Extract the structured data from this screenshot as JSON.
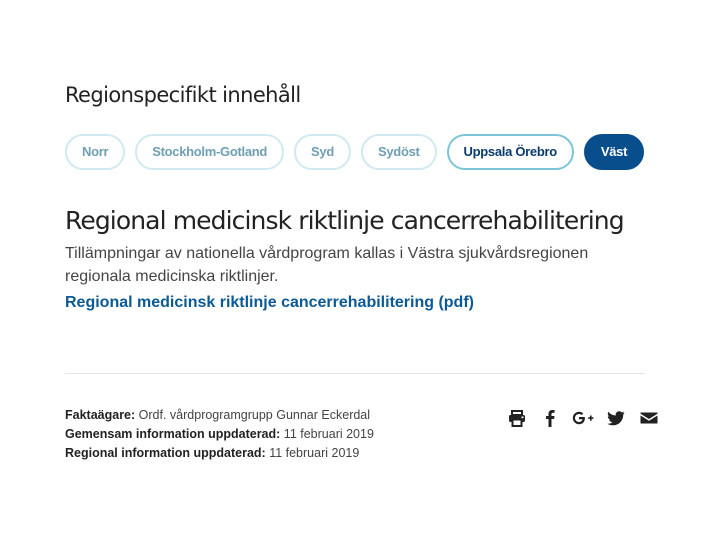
{
  "region_section": {
    "title": "Regionspecifikt innehåll",
    "regions": [
      {
        "label": "Norr",
        "state": "default"
      },
      {
        "label": "Stockholm-Gotland",
        "state": "default"
      },
      {
        "label": "Syd",
        "state": "default"
      },
      {
        "label": "Sydöst",
        "state": "default"
      },
      {
        "label": "Uppsala Örebro",
        "state": "highlight"
      },
      {
        "label": "Väst",
        "state": "active"
      }
    ]
  },
  "content": {
    "heading": "Regional medicinsk riktlinje cancerrehabilitering",
    "body": "Tillämpningar av nationella vårdprogram kallas i Västra sjukvårdsregionen regionala medicinska riktlinjer.",
    "link_label": "Regional medicinsk riktlinje cancerrehabilitering (pdf)"
  },
  "meta": {
    "owner_label": "Faktaägare:",
    "owner_value": "Ordf. vårdprogramgrupp Gunnar Eckerdal",
    "common_label": "Gemensam information uppdaterad:",
    "common_value": "11 februari 2019",
    "regional_label": "Regional information uppdaterad:",
    "regional_value": "11 februari 2019"
  },
  "share": {
    "icons": [
      "print-icon",
      "facebook-icon",
      "google-plus-icon",
      "twitter-icon",
      "email-icon"
    ]
  },
  "colors": {
    "active_pill": "#084e8d",
    "pill_border": "#cfeaf0",
    "pill_text": "#6f9fb2",
    "link": "#0b5a95",
    "icon": "#222222"
  }
}
